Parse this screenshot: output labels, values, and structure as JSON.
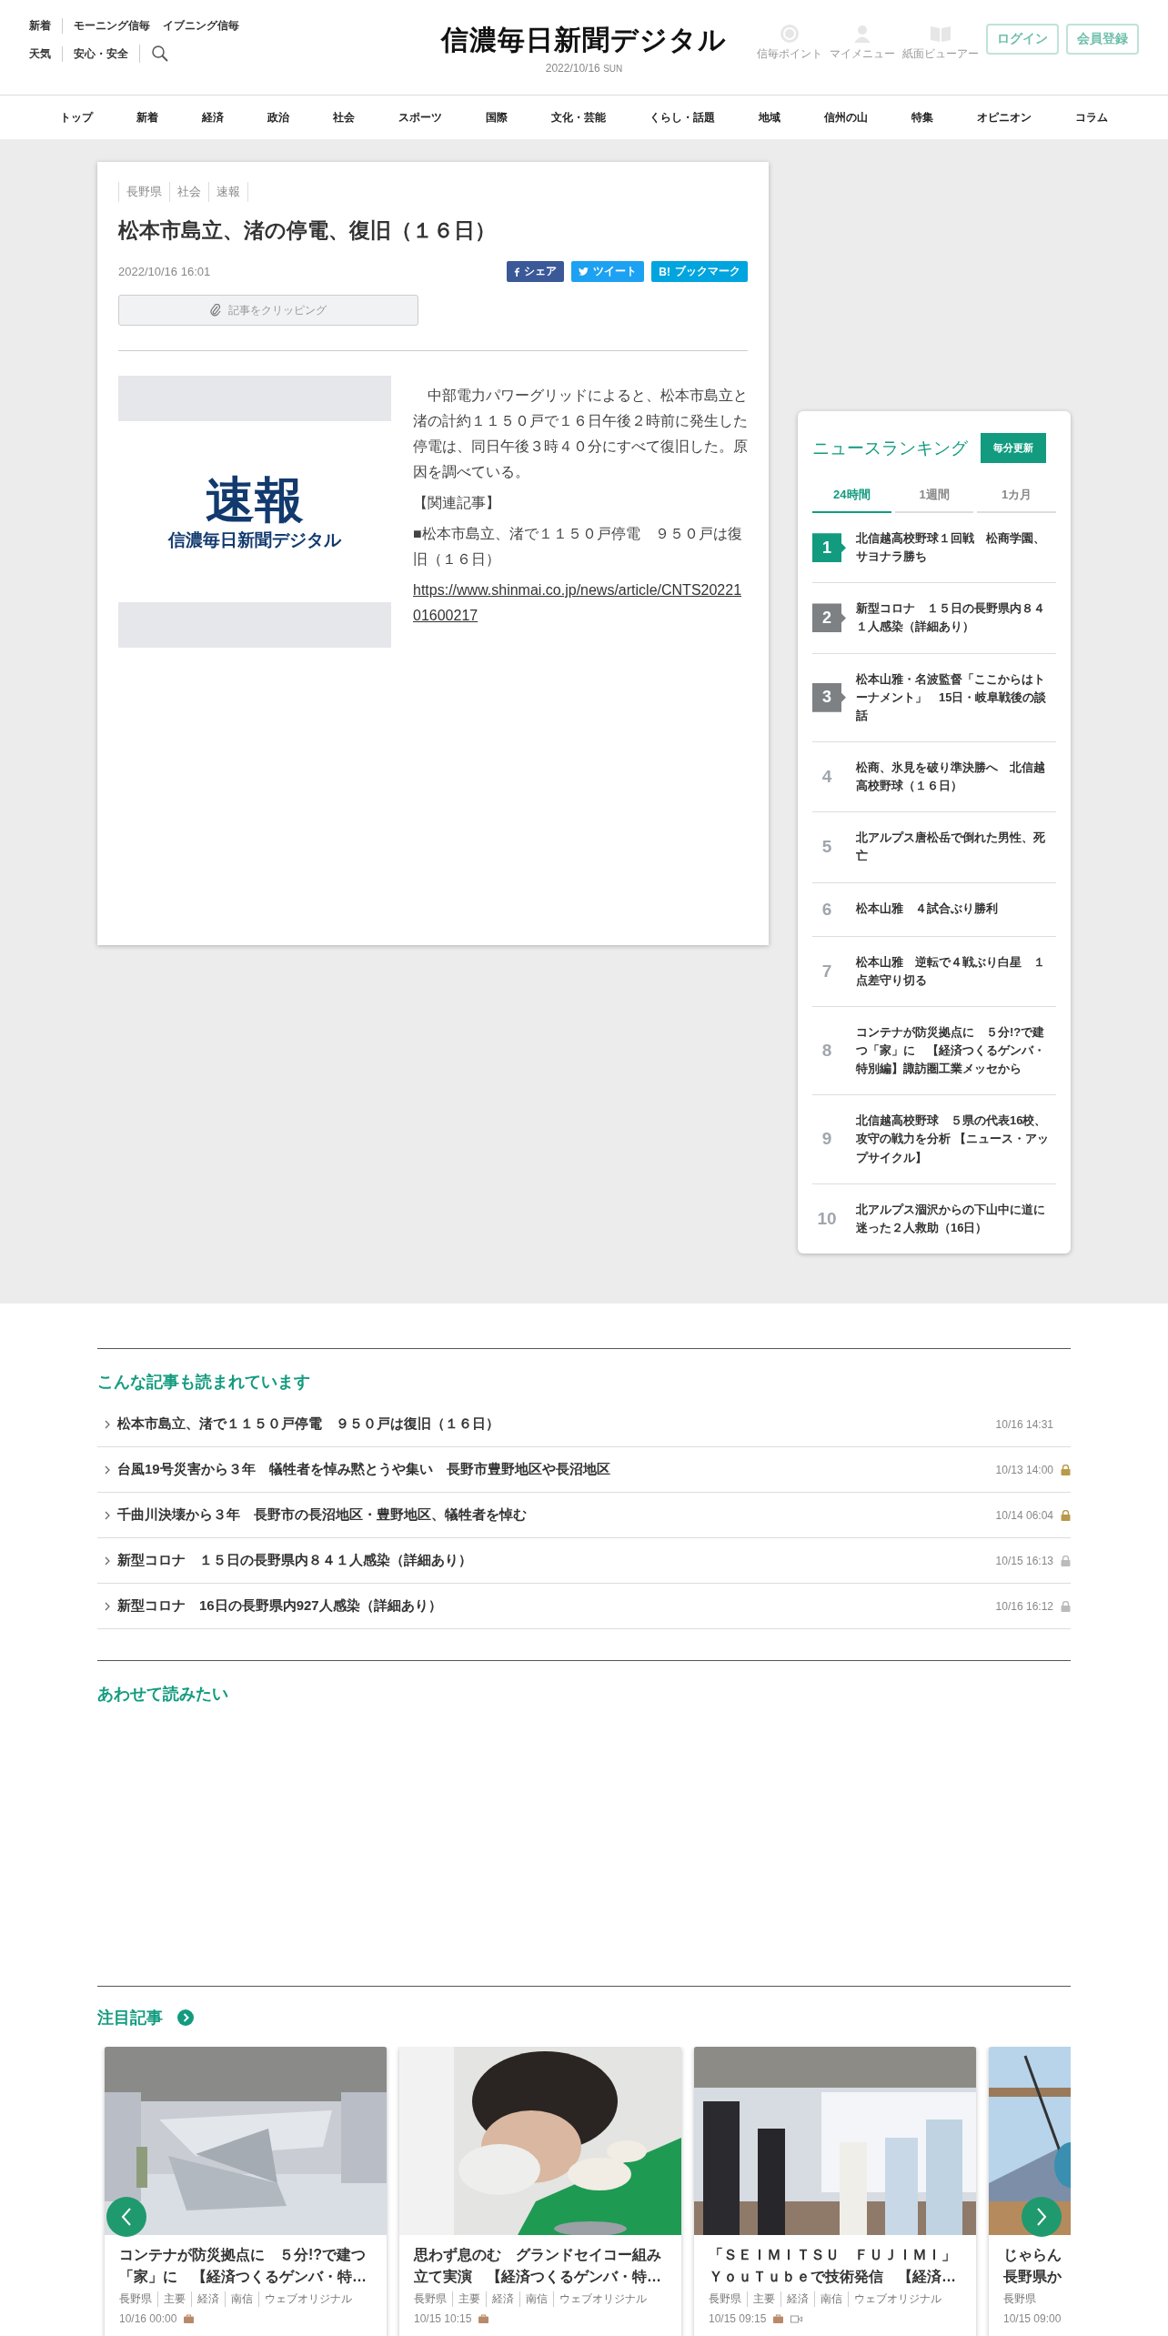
{
  "header": {
    "top_links": [
      [
        "新着"
      ],
      [
        "モーニング信毎",
        "イブニング信毎"
      ]
    ],
    "bottom_links": [
      [
        "天気"
      ],
      [
        "安心・安全"
      ]
    ],
    "logo": "信濃毎日新聞デジタル",
    "date": "2022/10/16",
    "weekday": "SUN",
    "tools": [
      {
        "kind": "point",
        "label": "信毎ポイント"
      },
      {
        "kind": "user",
        "label": "マイメニュー"
      },
      {
        "kind": "book",
        "label": "紙面ビューアー"
      }
    ],
    "buttons": [
      "ログイン",
      "会員登録"
    ]
  },
  "nav": [
    "トップ",
    "新着",
    "経済",
    "政治",
    "社会",
    "スポーツ",
    "国際",
    "文化・芸能",
    "くらし・話題",
    "地域",
    "信州の山",
    "特集",
    "オピニオン",
    "コラム"
  ],
  "article": {
    "tags": [
      "長野県",
      "社会",
      "速報"
    ],
    "title": "松本市島立、渚の停電、復旧（１６日）",
    "date": "2022/10/16 16:01",
    "share": [
      {
        "kind": "facebook",
        "label": "シェア"
      },
      {
        "kind": "twitter",
        "label": "ツイート"
      },
      {
        "kind": "hatena",
        "mark": "B!",
        "label": "ブックマーク"
      }
    ],
    "clip_button": "記事をクリッピング",
    "image": {
      "headline": "速報",
      "brand": "信濃毎日新聞デジタル"
    },
    "body": [
      "　中部電力パワーグリッドによると、松本市島立と渚の計約１１５０戸で１６日午後２時前に発生した停電は、同日午後３時４０分にすべて復旧した。原因を調べている。",
      "【関連記事】",
      "■松本市島立、渚で１１５０戸停電　９５０戸は復旧（１６日）"
    ],
    "link": "https://www.shinmai.co.jp/news/article/CNTS2022101600217"
  },
  "ranking": {
    "title": "ニュースランキング",
    "update_button": "毎分更新",
    "tabs": [
      {
        "label": "24時間",
        "selected": true
      },
      {
        "label": "1週間",
        "selected": false
      },
      {
        "label": "1カ月",
        "selected": false
      }
    ],
    "items": [
      {
        "rank": "1",
        "kind": "top",
        "title": "北信越高校野球１回戦　松商学園、サヨナラ勝ち"
      },
      {
        "rank": "2",
        "kind": "badge",
        "title": "新型コロナ　１５日の長野県内８４１人感染（詳細あり）"
      },
      {
        "rank": "3",
        "kind": "badge",
        "title": "松本山雅・名波監督「ここからはトーナメント」　15日・岐阜戦後の談話"
      },
      {
        "rank": "4",
        "kind": "plain",
        "title": "松商、氷見を破り準決勝へ　北信越高校野球（１６日）"
      },
      {
        "rank": "5",
        "kind": "plain",
        "title": "北アルプス唐松岳で倒れた男性、死亡"
      },
      {
        "rank": "6",
        "kind": "plain",
        "title": "松本山雅　４試合ぶり勝利"
      },
      {
        "rank": "7",
        "kind": "plain",
        "title": "松本山雅　逆転で４戦ぶり白星　１点差守り切る"
      },
      {
        "rank": "8",
        "kind": "plain",
        "title": "コンテナが防災拠点に　５分!?で建つ「家」に　【経済つくるゲンバ・特別編】諏訪圏工業メッセから"
      },
      {
        "rank": "9",
        "kind": "plain",
        "title": "北信越高校野球　５県の代表16校、攻守の戦力を分析 【ニュース・アップサイクル】"
      },
      {
        "rank": "10",
        "kind": "plain",
        "title": "北アルプス涸沢からの下山中に道に迷った２人救助（16日）"
      }
    ]
  },
  "popular": {
    "heading": "こんな記事も読まれています",
    "items": [
      {
        "title": "松本市島立、渚で１１５０戸停電　９５０戸は復旧（１６日）",
        "date": "10/16 14:31",
        "locked": false
      },
      {
        "title": "台風19号災害から３年　犠牲者を悼み黙とうや集い　長野市豊野地区や長沼地区",
        "date": "10/13 14:00",
        "locked": true,
        "color": "#b89b4a"
      },
      {
        "title": "千曲川決壊から３年　長野市の長沼地区・豊野地区、犠牲者を悼む",
        "date": "10/14 06:04",
        "locked": true,
        "color": "#b89b4a"
      },
      {
        "title": "新型コロナ　１５日の長野県内８４１人感染（詳細あり）",
        "date": "10/15 16:13",
        "locked": true,
        "color": "#bbbbbb"
      },
      {
        "title": "新型コロナ　16日の長野県内927人感染（詳細あり）",
        "date": "10/16 16:12",
        "locked": true,
        "color": "#bbbbbb"
      }
    ]
  },
  "also_read": {
    "heading": "あわせて読みたい"
  },
  "featured": {
    "heading": "注目記事",
    "cards": [
      {
        "kind": "picture",
        "title_lines": [
          "コンテナが防災拠点に　５分!?で建つ",
          "「家」に　【経済つくるゲンバ・特…"
        ],
        "tags": [
          "長野県",
          "主要",
          "経済",
          "南信",
          "ウェブオリジナル"
        ],
        "date": "10/16 00:00",
        "locked": true,
        "video": false
      },
      {
        "kind": "picture",
        "title_lines": [
          "思わず息のむ　グランドセイコー組み",
          "立て実演　【経済つくるゲンバ・特…"
        ],
        "tags": [
          "長野県",
          "主要",
          "経済",
          "南信",
          "ウェブオリジナル"
        ],
        "date": "10/15 10:15",
        "locked": true,
        "video": false
      },
      {
        "kind": "picture",
        "title_lines": [
          "「ＳＥＩＭＩＴＳＵ　ＦＵＪＩＭＩ」",
          "ＹｏｕＴｕｂｅで技術発信　【経済…"
        ],
        "tags": [
          "長野県",
          "主要",
          "経済",
          "南信",
          "ウェブオリジナル"
        ],
        "date": "10/15 09:15",
        "locked": true,
        "video": true
      },
      {
        "kind": "picture",
        "title_lines": [
          "じゃらん",
          "長野県か"
        ],
        "tags": [
          "長野県"
        ],
        "date": "10/15 09:00",
        "locked": false,
        "video": false
      }
    ]
  }
}
